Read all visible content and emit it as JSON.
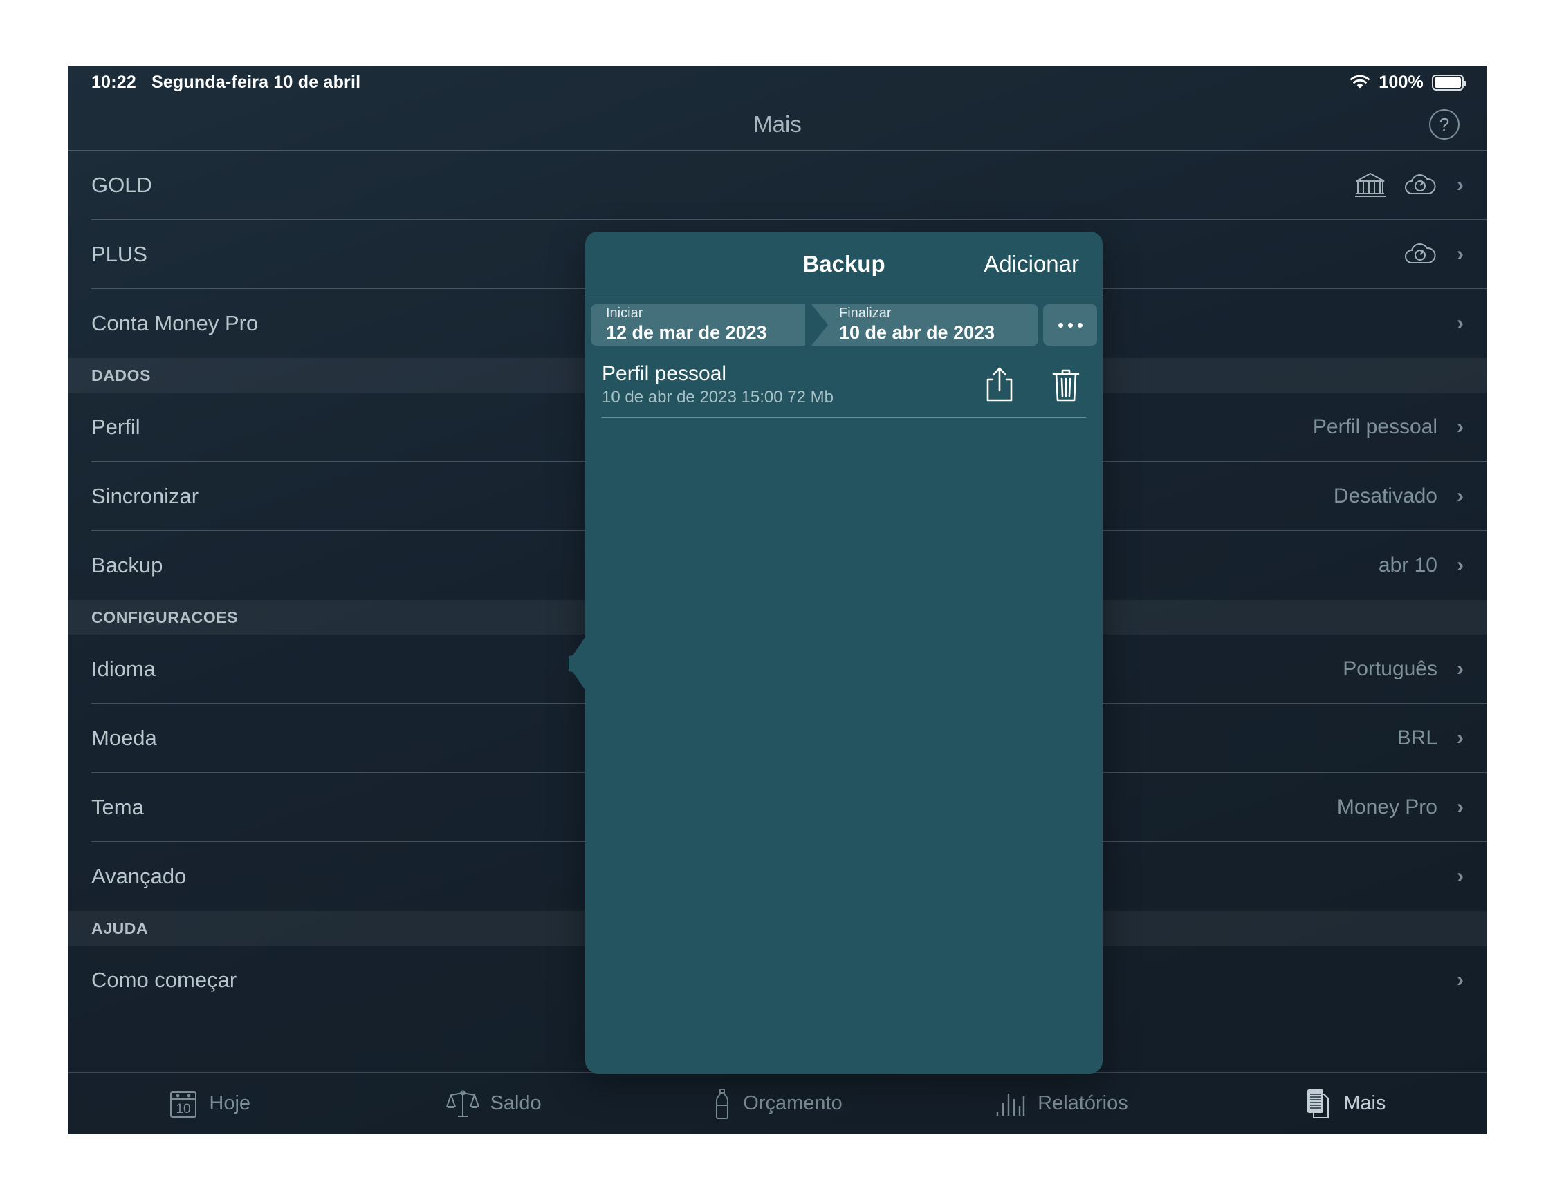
{
  "status_bar": {
    "time": "10:22",
    "date": "Segunda-feira 10 de abril",
    "wifi_icon": "wifi-icon",
    "battery_percent": "100%",
    "battery_icon": "battery-full-icon"
  },
  "nav_bar": {
    "title": "Mais",
    "help_label": "?",
    "help_icon": "question-mark-circle-icon"
  },
  "list": [
    {
      "kind": "row",
      "label": "GOLD",
      "value": "",
      "icons": [
        "bank-icon",
        "cloud-sync-icon"
      ],
      "chevron": "›"
    },
    {
      "kind": "row",
      "label": "PLUS",
      "value": "",
      "icons": [
        "cloud-sync-icon"
      ],
      "chevron": "›"
    },
    {
      "kind": "row",
      "label": "Conta Money Pro",
      "value": "",
      "icons": [],
      "chevron": "›"
    },
    {
      "kind": "header",
      "label": "DADOS"
    },
    {
      "kind": "row",
      "label": "Perfil",
      "value": "Perfil pessoal",
      "icons": [],
      "chevron": "›"
    },
    {
      "kind": "row",
      "label": "Sincronizar",
      "value": "Desativado",
      "icons": [],
      "chevron": "›"
    },
    {
      "kind": "row",
      "label": "Backup",
      "value": "abr 10",
      "icons": [],
      "chevron": "›"
    },
    {
      "kind": "header",
      "label": "CONFIGURACOES"
    },
    {
      "kind": "row",
      "label": "Idioma",
      "value": "Português",
      "icons": [],
      "chevron": "›"
    },
    {
      "kind": "row",
      "label": "Moeda",
      "value": "BRL",
      "icons": [],
      "chevron": "›"
    },
    {
      "kind": "row",
      "label": "Tema",
      "value": "Money Pro",
      "icons": [],
      "chevron": "›"
    },
    {
      "kind": "row",
      "label": "Avançado",
      "value": "",
      "icons": [],
      "chevron": "›"
    },
    {
      "kind": "header",
      "label": "AJUDA"
    },
    {
      "kind": "row",
      "label": "Como começar",
      "value": "",
      "icons": [],
      "chevron": "›"
    }
  ],
  "popover": {
    "title": "Backup",
    "add_label": "Adicionar",
    "range": {
      "start_caption": "Iniciar",
      "start_value": "12 de mar de 2023",
      "end_caption": "Finalizar",
      "end_value": "10 de abr de 2023"
    },
    "more_icon": "ellipsis-icon",
    "items": [
      {
        "name": "Perfil pessoal",
        "meta": "10 de abr de 2023 15:00 72 Mb",
        "share_icon": "share-icon",
        "delete_icon": "trash-icon"
      }
    ]
  },
  "tab_bar": [
    {
      "label": "Hoje",
      "icon": "calendar-10-icon",
      "active": false
    },
    {
      "label": "Saldo",
      "icon": "scales-icon",
      "active": false
    },
    {
      "label": "Orçamento",
      "icon": "bottle-icon",
      "active": false
    },
    {
      "label": "Relatórios",
      "icon": "bar-chart-icon",
      "active": false
    },
    {
      "label": "Mais",
      "icon": "documents-icon",
      "active": true
    }
  ],
  "colors": {
    "background": "#16222e",
    "popover": "#23545f",
    "segment": "#43707a",
    "text_primary": "#b9c6cc",
    "text_secondary": "#7e9199",
    "white": "#ffffff"
  }
}
